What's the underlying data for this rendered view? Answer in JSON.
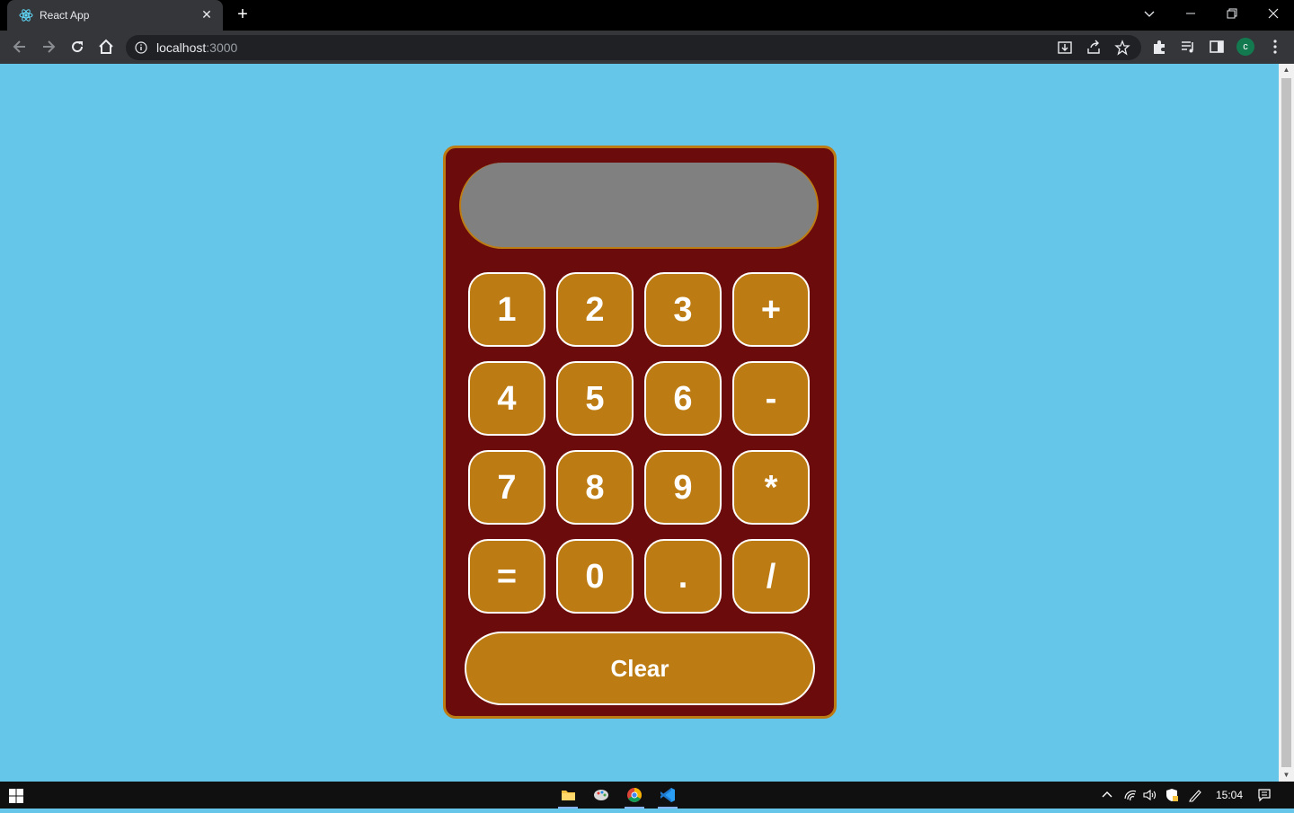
{
  "browser": {
    "tab_title": "React App",
    "url_host": "localhost",
    "url_port": ":3000",
    "new_tab": "+",
    "close_tab": "✕",
    "profile_initial": "c"
  },
  "calculator": {
    "display": "",
    "keys": [
      [
        "1",
        "2",
        "3",
        "+"
      ],
      [
        "4",
        "5",
        "6",
        "-"
      ],
      [
        "7",
        "8",
        "9",
        "*"
      ],
      [
        "=",
        "0",
        ".",
        "/"
      ]
    ],
    "clear": "Clear",
    "colors": {
      "background": "#66c6ea",
      "body": "#6c0b0b",
      "accent": "#bd7c13",
      "display": "#808080"
    }
  },
  "taskbar": {
    "clock": "15:04"
  }
}
